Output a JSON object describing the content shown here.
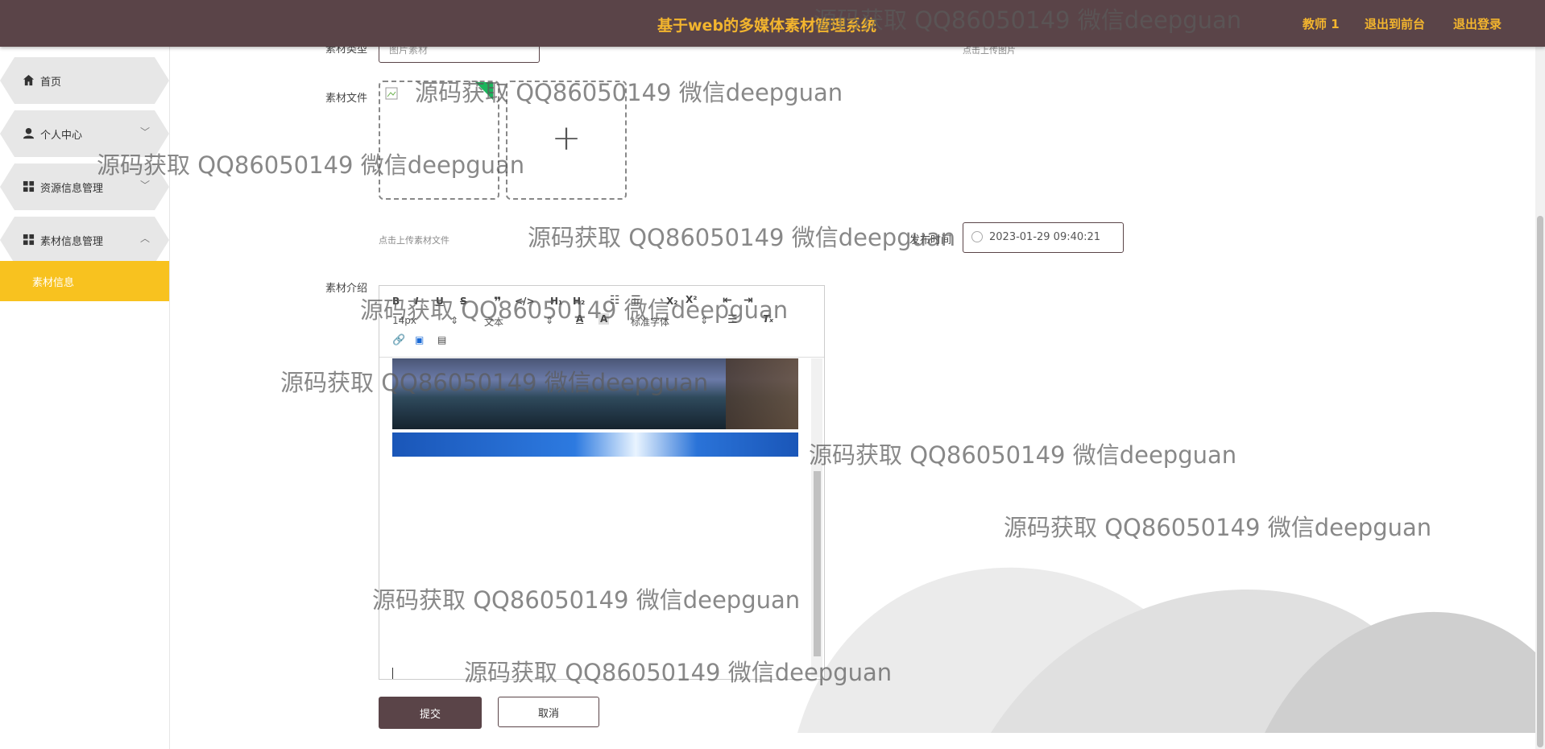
{
  "header": {
    "app_title": "基于web的多媒体素材管理系统",
    "user_label": "教师 1",
    "front_link": "退出到前台",
    "logout_link": "退出登录",
    "bg_color": "#5a4448",
    "accent_color": "#f3b52e"
  },
  "sidebar": {
    "items": [
      {
        "label": "首页",
        "icon": "home-icon"
      },
      {
        "label": "个人中心",
        "icon": "user-icon"
      },
      {
        "label": "资源信息管理",
        "icon": "grid-icon"
      },
      {
        "label": "素材信息管理",
        "icon": "grid-icon"
      }
    ],
    "active_sub": "素材信息",
    "active_color": "#f8c21f"
  },
  "form": {
    "type_label": "素材类型",
    "type_value": "图片素材",
    "top_upload_hint": "点击上传图片",
    "file_label": "素材文件",
    "file_hint": "点击上传素材文件",
    "time_label": "发布时间",
    "time_value": "2023-01-29 09:40:21",
    "intro_label": "素材介绍"
  },
  "editor": {
    "font_size": "14px",
    "paragraph": "文本",
    "font_family": "标准字体"
  },
  "buttons": {
    "submit": "提交",
    "cancel": "取消"
  },
  "watermark": "源码获取 QQ86050149 微信deepguan"
}
